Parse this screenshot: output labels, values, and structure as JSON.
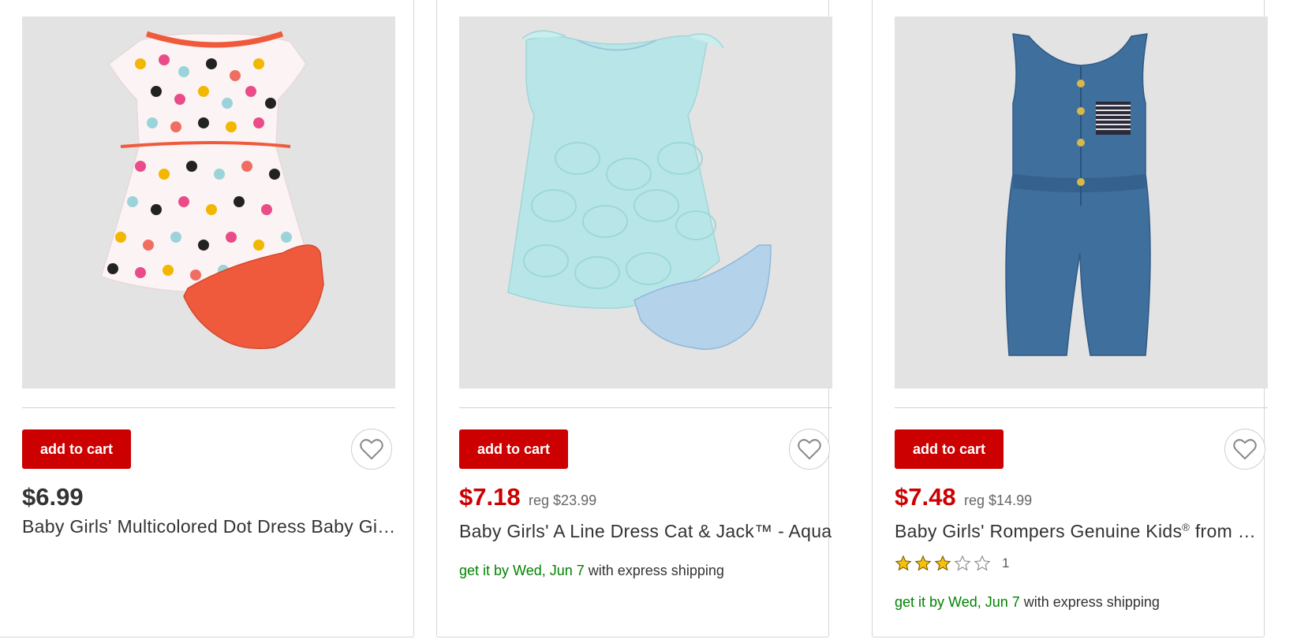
{
  "products": [
    {
      "image_alt": "multicolored dot dress with orange bloomers",
      "add_to_cart_label": "add to cart",
      "favorite_icon": "heart-outline-icon",
      "price": "$6.99",
      "price_is_sale": false,
      "reg_price": "",
      "title": "Baby Girls' Multicolored Dot Dress Baby Girls' Multicolored Dot Dress Cat & Jack",
      "shipping_prefix": "",
      "shipping_suffix": ""
    },
    {
      "image_alt": "light aqua a-line dress with light blue bloomers",
      "add_to_cart_label": "add to cart",
      "favorite_icon": "heart-outline-icon",
      "price": "$7.18",
      "price_is_sale": true,
      "reg_price": "reg $23.99",
      "title": "Baby Girls' A Line Dress Cat & Jack™ - Aqua",
      "shipping_prefix": "get it by Wed, Jun 7",
      "shipping_suffix": " with express shipping"
    },
    {
      "image_alt": "denim sleeveless romper with striped pocket",
      "add_to_cart_label": "add to cart",
      "favorite_icon": "heart-outline-icon",
      "price": "$7.48",
      "price_is_sale": true,
      "reg_price": "reg $14.99",
      "title_main": "Baby Girls' Rompers Genuine Kids",
      "title_mark": "®",
      "title_rest": " from OshKosh Denim",
      "rating": 3,
      "rating_max": 5,
      "review_count": "1",
      "shipping_prefix": "get it by Wed, Jun 7",
      "shipping_suffix": " with express shipping"
    }
  ],
  "colors": {
    "brand_red": "#cc0000",
    "shipping_green": "#008300",
    "image_bg": "#e3e3e3",
    "star_gold": "#f4c20d"
  }
}
